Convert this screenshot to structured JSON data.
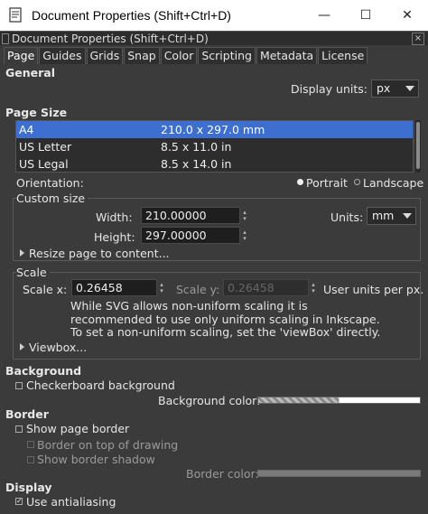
{
  "window": {
    "title": "Document Properties (Shift+Ctrl+D)",
    "minimize_glyph": "—",
    "maximize_glyph": "☐",
    "close_glyph": "✕"
  },
  "dock": {
    "title": "Document Properties (Shift+Ctrl+D)",
    "close_glyph": "×"
  },
  "tabs": [
    "Page",
    "Guides",
    "Grids",
    "Snap",
    "Color",
    "Scripting",
    "Metadata",
    "License"
  ],
  "general": {
    "heading": "General",
    "display_units_label": "Display units:",
    "display_units_value": "px"
  },
  "page_size": {
    "heading": "Page Size",
    "rows": [
      {
        "name": "A4",
        "size": "210.0 x 297.0 mm",
        "selected": true
      },
      {
        "name": "US Letter",
        "size": "8.5 x 11.0 in",
        "selected": false
      },
      {
        "name": "US Legal",
        "size": "8.5 x 14.0 in",
        "selected": false
      }
    ],
    "orientation_label": "Orientation:",
    "portrait_label": "Portrait",
    "landscape_label": "Landscape"
  },
  "custom_size": {
    "heading": "Custom size",
    "width_label": "Width:",
    "width_value": "210.00000",
    "height_label": "Height:",
    "height_value": "297.00000",
    "units_label": "Units:",
    "units_value": "mm",
    "resize_label": "Resize page to content..."
  },
  "scale": {
    "heading": "Scale",
    "scale_x_label": "Scale x:",
    "scale_x_value": "0.26458",
    "scale_y_label": "Scale y:",
    "scale_y_value": "0.26458",
    "per_px_label": "User units per px.",
    "note_line1": "While SVG allows non-uniform scaling it is",
    "note_line2": "recommended to use only uniform scaling in Inkscape.",
    "note_line3": "To set a non-uniform scaling, set the 'viewBox' directly.",
    "viewbox_label": "Viewbox..."
  },
  "background": {
    "heading": "Background",
    "checkerboard_label": "Checkerboard background",
    "color_label": "Background color:"
  },
  "border": {
    "heading": "Border",
    "show_border_label": "Show page border",
    "on_top_label": "Border on top of drawing",
    "shadow_label": "Show border shadow",
    "color_label": "Border color:"
  },
  "display": {
    "heading": "Display",
    "antialias_label": "Use antialiasing"
  },
  "colors": {
    "selection": "#3c6fd0",
    "panel_bg": "#3b3b3b"
  }
}
